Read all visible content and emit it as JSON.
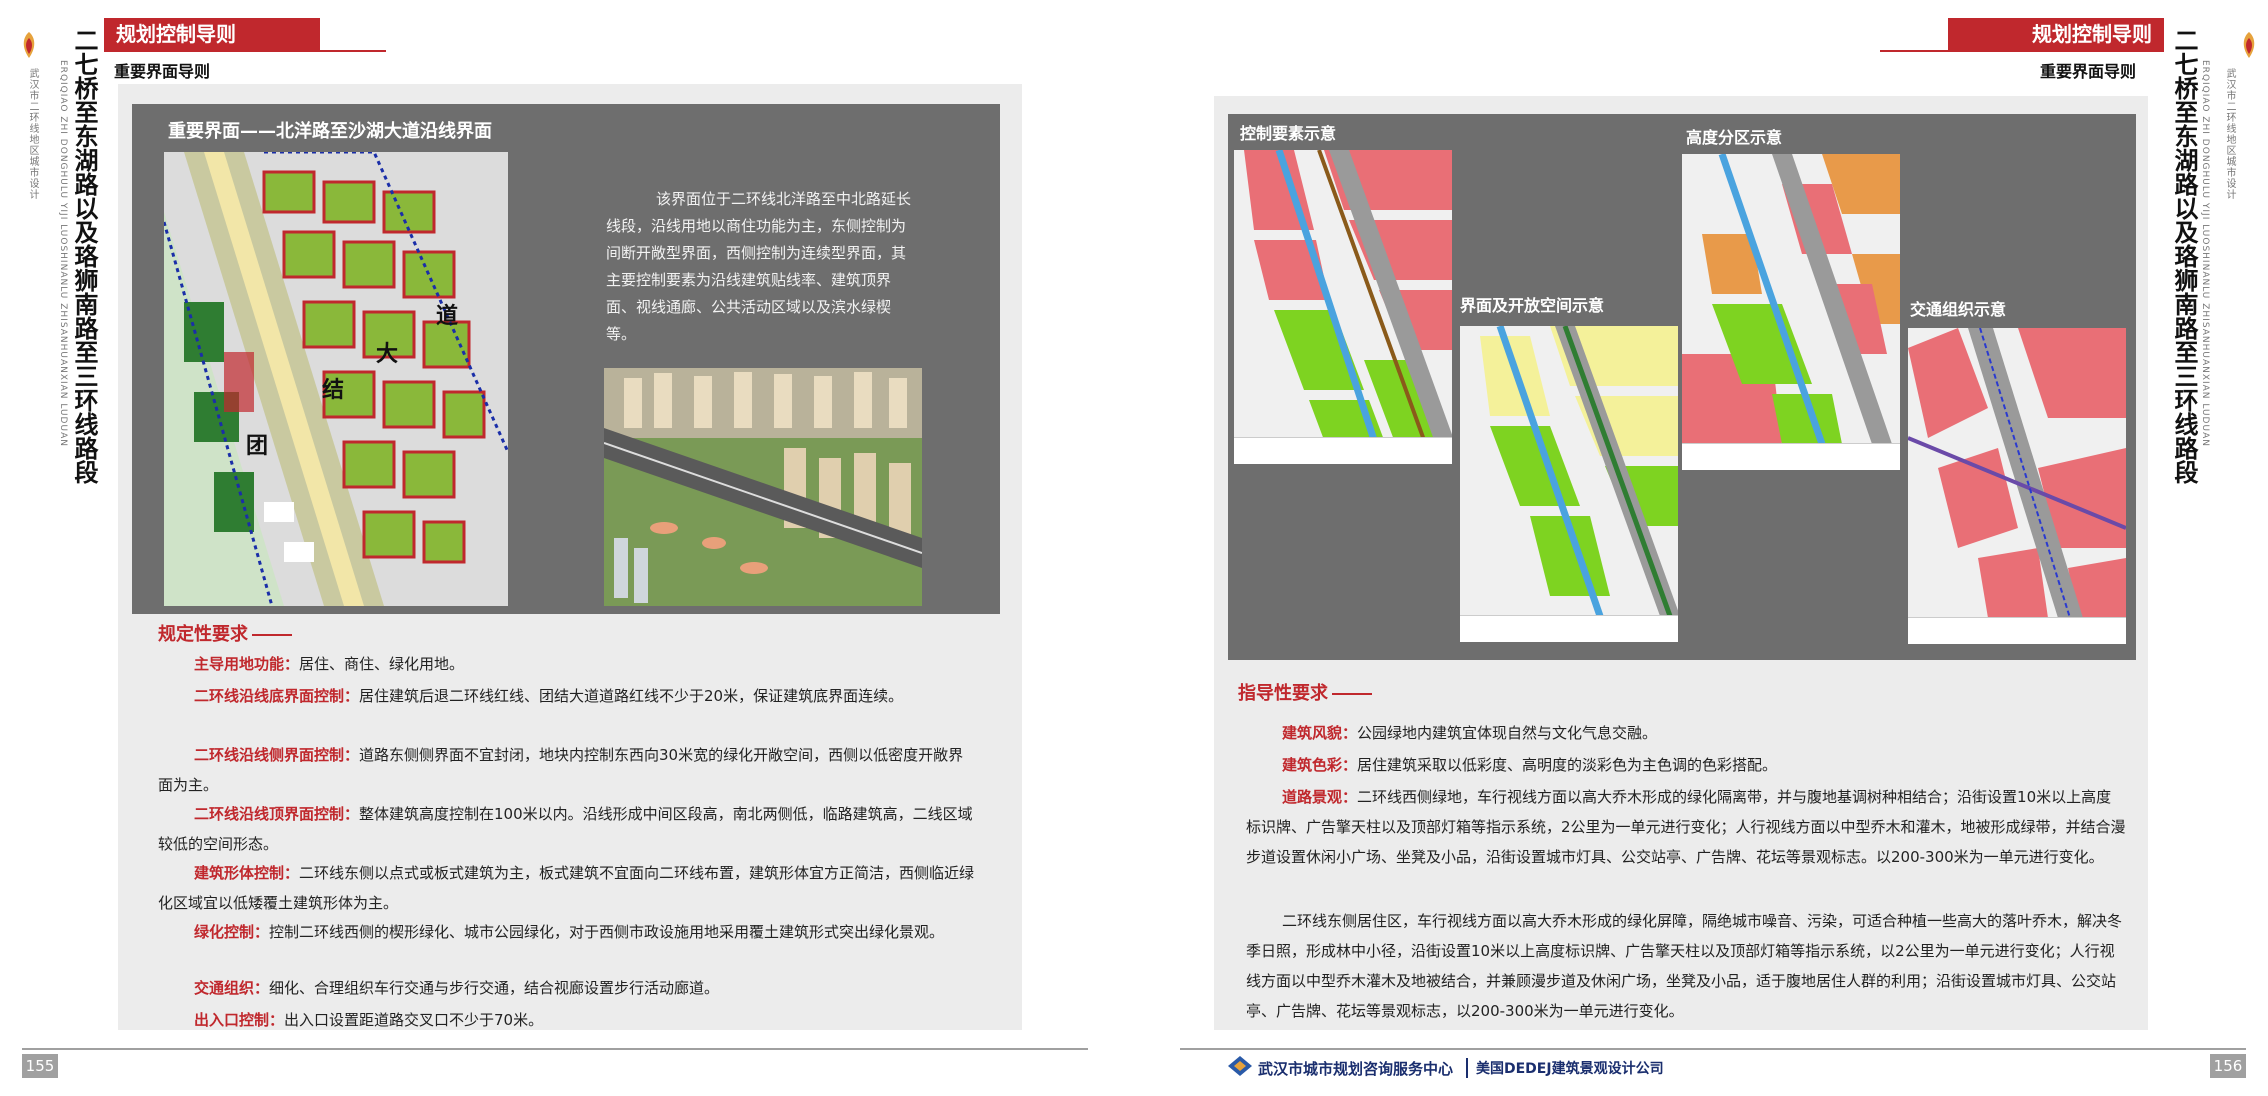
{
  "spine": {
    "title": "二七桥至东湖路以及珞狮南路至三环线路段",
    "subtitle": "武汉市二环线地区城市设计",
    "pinyin": "ERQIQIAO ZHI DONGHULU YIJI LUOSHINANLU ZHISANHUANXIAN LUDUAN"
  },
  "left_page": {
    "header": "规划控制导则",
    "subheader": "重要界面导则",
    "panel_title": "重要界面——北洋路至沙湖大道沿线界面",
    "map_labels": [
      "团",
      "结",
      "大",
      "道"
    ],
    "description": "该界面位于二环线北洋路至中北路延长线段，沿线用地以商住功能为主，东侧控制为间断开敞型界面，西侧控制为连续型界面，其主要控制要素为沿线建筑贴线率、建筑顶界面、视线通廊、公共活动区域以及滨水绿楔等。",
    "section_title": "规定性要求",
    "items": [
      {
        "key": "主导用地功能：",
        "text": "居住、商住、绿化用地。"
      },
      {
        "key": "二环线沿线底界面控制：",
        "text": "居住建筑后退二环线红线、团结大道道路红线不少于20米，保证建筑底界面连续。"
      },
      {
        "key": "二环线沿线侧界面控制：",
        "text": "道路东侧侧界面不宜封闭，地块内控制东西向30米宽的绿化开敞空间，西侧以低密度开敞界面为主。"
      },
      {
        "key": "二环线沿线顶界面控制：",
        "text": "整体建筑高度控制在100米以内。沿线形成中间区段高，南北两侧低，临路建筑高，二线区域较低的空间形态。"
      },
      {
        "key": "建筑形体控制：",
        "text": "二环线东侧以点式或板式建筑为主，板式建筑不宜面向二环线布置，建筑形体宜方正简洁，西侧临近绿化区域宜以低矮覆土建筑形体为主。"
      },
      {
        "key": "绿化控制：",
        "text": "控制二环线西侧的楔形绿化、城市公园绿化，对于西侧市政设施用地采用覆土建筑形式突出绿化景观。"
      },
      {
        "key": "交通组织：",
        "text": "细化、合理组织车行交通与步行交通，结合视廊设置步行活动廊道。"
      },
      {
        "key": "出入口控制：",
        "text": "出入口设置距道路交叉口不少于70米。"
      }
    ],
    "page_number": "155"
  },
  "right_page": {
    "header": "规划控制导则",
    "subheader": "重要界面导则",
    "diagrams": [
      {
        "title": "控制要素示意"
      },
      {
        "title": "界面及开放空间示意"
      },
      {
        "title": "高度分区示意"
      },
      {
        "title": "交通组织示意"
      }
    ],
    "section_title": "指导性要求",
    "items": [
      {
        "key": "建筑风貌：",
        "text": "公园绿地内建筑宜体现自然与文化气息交融。"
      },
      {
        "key": "建筑色彩：",
        "text": "居住建筑采取以低彩度、高明度的淡彩色为主色调的色彩搭配。"
      },
      {
        "key": "道路景观：",
        "text": "二环线西侧绿地，车行视线方面以高大乔木形成的绿化隔离带，并与腹地基调树种相结合；沿街设置10米以上高度标识牌、广告擎天柱以及顶部灯箱等指示系统，2公里为一单元进行变化；人行视线方面以中型乔木和灌木，地被形成绿带，并结合漫步道设置休闲小广场、坐凳及小品，沿街设置城市灯具、公交站亭、广告牌、花坛等景观标志。以200-300米为一单元进行变化。"
      }
    ],
    "extra_paragraph": "二环线东侧居住区，车行视线方面以高大乔木形成的绿化屏障，隔绝城市噪音、污染，可适合种植一些高大的落叶乔木，解决冬季日照，形成林中小径，沿街设置10米以上高度标识牌、广告擎天柱以及顶部灯箱等指示系统，以2公里为一单元进行变化；人行视线方面以中型乔木灌木及地被结合，并兼顾漫步道及休闲广场，坐凳及小品，适于腹地居住人群的利用；沿街设置城市灯具、公交站亭、广告牌、花坛等景观标志，以200-300米为一单元进行变化。",
    "footer_org1": "武汉市城市规划咨询服务中心",
    "footer_org2": "美国DEDEJ建筑景观设计公司",
    "page_number": "156"
  },
  "colors": {
    "accent": "#c0282d",
    "panel": "#6e6e6e",
    "pink": "#e96f76",
    "green": "#7ed321",
    "yellow": "#f4f19a",
    "orange": "#e89a4a"
  }
}
